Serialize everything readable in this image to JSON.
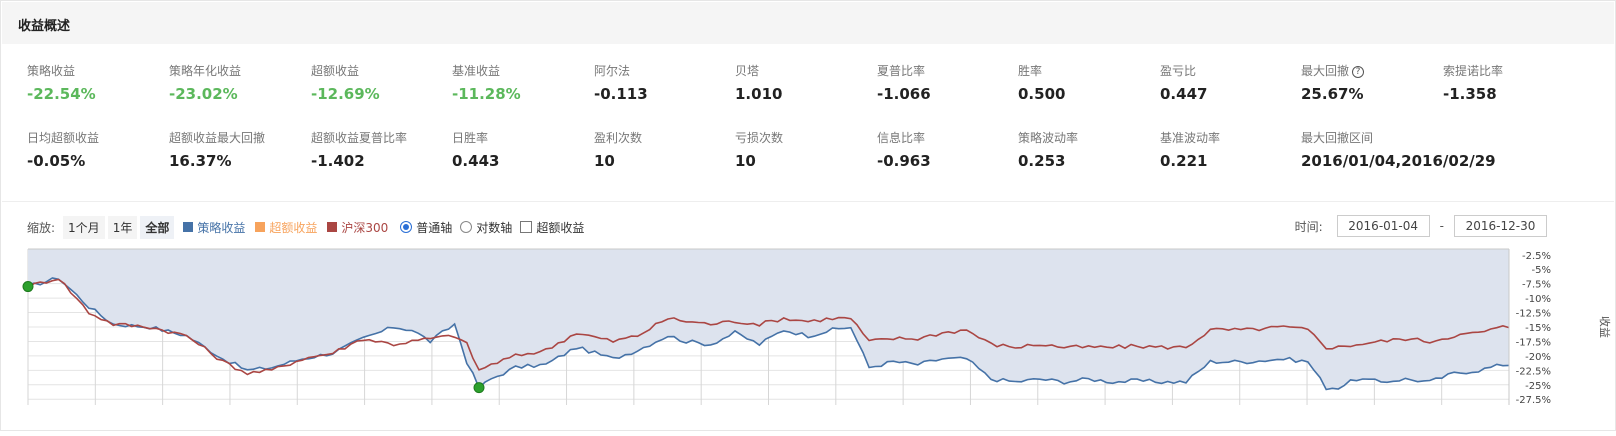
{
  "header": {
    "title": "收益概述"
  },
  "metrics_row1": [
    {
      "label": "策略收益",
      "value": "-22.54%",
      "neg": true
    },
    {
      "label": "策略年化收益",
      "value": "-23.02%",
      "neg": true
    },
    {
      "label": "超额收益",
      "value": "-12.69%",
      "neg": true
    },
    {
      "label": "基准收益",
      "value": "-11.28%",
      "neg": true
    },
    {
      "label": "阿尔法",
      "value": "-0.113",
      "neg": false
    },
    {
      "label": "贝塔",
      "value": "1.010",
      "neg": false
    },
    {
      "label": "夏普比率",
      "value": "-1.066",
      "neg": false
    },
    {
      "label": "胜率",
      "value": "0.500",
      "neg": false
    },
    {
      "label": "盈亏比",
      "value": "0.447",
      "neg": false
    },
    {
      "label": "最大回撤",
      "value": "25.67%",
      "neg": false,
      "help": "?"
    },
    {
      "label": "索提诺比率",
      "value": "-1.358",
      "neg": false
    }
  ],
  "metrics_row2": [
    {
      "label": "日均超额收益",
      "value": "-0.05%"
    },
    {
      "label": "超额收益最大回撤",
      "value": "16.37%"
    },
    {
      "label": "超额收益夏普比率",
      "value": "-1.402"
    },
    {
      "label": "日胜率",
      "value": "0.443"
    },
    {
      "label": "盈利次数",
      "value": "10"
    },
    {
      "label": "亏损次数",
      "value": "10"
    },
    {
      "label": "信息比率",
      "value": "-0.963"
    },
    {
      "label": "策略波动率",
      "value": "0.253"
    },
    {
      "label": "基准波动率",
      "value": "0.221"
    },
    {
      "label": "最大回撤区间",
      "value": "2016/01/04,2016/02/29"
    }
  ],
  "toolbar": {
    "zoom_label": "缩放:",
    "zoom_buttons": [
      "1个月",
      "1年",
      "全部"
    ],
    "legend": [
      {
        "label": "策略收益",
        "color": "#4572a7"
      },
      {
        "label": "超额收益",
        "color": "#f7a35c"
      },
      {
        "label": "沪深300",
        "color": "#aa4643"
      }
    ],
    "axis_normal": "普通轴",
    "axis_log": "对数轴",
    "excess_checkbox": "超额收益",
    "time_label": "时间:",
    "date_from": "2016-01-04",
    "date_to": "2016-12-30",
    "date_sep": "-"
  },
  "chart_data": {
    "type": "line",
    "ylabel": "收益",
    "ylim": [
      -28.5,
      -1.5
    ],
    "yticks": [
      -2.5,
      -5,
      -7.5,
      -10,
      -12.5,
      -15,
      -17.5,
      -20,
      -22.5,
      -25,
      -27.5
    ],
    "ytick_labels": [
      "-2.5%",
      "-5%",
      "-7.5%",
      "-10%",
      "-12.5%",
      "-15%",
      "-17.5%",
      "-20%",
      "-22.5%",
      "-25%",
      "-27.5%"
    ],
    "n_points": 244,
    "grid": true,
    "series": [
      {
        "name": "策略收益",
        "color": "#4572a7",
        "fill": true,
        "anchors": [
          [
            0,
            -8
          ],
          [
            5,
            -6.5
          ],
          [
            10,
            -11.5
          ],
          [
            14,
            -14.5
          ],
          [
            20,
            -15
          ],
          [
            26,
            -16.5
          ],
          [
            32,
            -20.5
          ],
          [
            36,
            -22.5
          ],
          [
            40,
            -22
          ],
          [
            45,
            -20.5
          ],
          [
            50,
            -19.5
          ],
          [
            55,
            -17
          ],
          [
            60,
            -15
          ],
          [
            63,
            -15.5
          ],
          [
            66,
            -17.5
          ],
          [
            70,
            -14.5
          ],
          [
            72,
            -21
          ],
          [
            74,
            -25.5
          ],
          [
            76,
            -24
          ],
          [
            80,
            -22
          ],
          [
            85,
            -21.5
          ],
          [
            90,
            -18.5
          ],
          [
            96,
            -20.5
          ],
          [
            100,
            -19
          ],
          [
            105,
            -16.5
          ],
          [
            108,
            -17.5
          ],
          [
            112,
            -18
          ],
          [
            116,
            -16
          ],
          [
            120,
            -18
          ],
          [
            124,
            -15.5
          ],
          [
            128,
            -16.5
          ],
          [
            132,
            -15.5
          ],
          [
            135,
            -15
          ],
          [
            138,
            -22
          ],
          [
            142,
            -21
          ],
          [
            146,
            -21.5
          ],
          [
            150,
            -20.5
          ],
          [
            154,
            -20.5
          ],
          [
            158,
            -24
          ],
          [
            162,
            -24.5
          ],
          [
            166,
            -24
          ],
          [
            170,
            -24.5
          ],
          [
            174,
            -24
          ],
          [
            178,
            -24.5
          ],
          [
            182,
            -24.3
          ],
          [
            186,
            -24.5
          ],
          [
            190,
            -24.5
          ],
          [
            194,
            -21
          ],
          [
            198,
            -21
          ],
          [
            200,
            -21
          ],
          [
            206,
            -20.5
          ],
          [
            210,
            -21
          ],
          [
            213,
            -25.5
          ],
          [
            215,
            -25.5
          ],
          [
            218,
            -24
          ],
          [
            222,
            -24.5
          ],
          [
            226,
            -24
          ],
          [
            230,
            -24.5
          ],
          [
            234,
            -23
          ],
          [
            238,
            -22.5
          ],
          [
            242,
            -21.5
          ],
          [
            244,
            -21.5
          ]
        ]
      },
      {
        "name": "沪深300",
        "color": "#aa4643",
        "fill": false,
        "anchors": [
          [
            0,
            -8
          ],
          [
            5,
            -6.5
          ],
          [
            10,
            -12.5
          ],
          [
            14,
            -14.5
          ],
          [
            20,
            -15
          ],
          [
            26,
            -16.5
          ],
          [
            32,
            -21
          ],
          [
            36,
            -23
          ],
          [
            40,
            -22.5
          ],
          [
            45,
            -20.5
          ],
          [
            50,
            -19.5
          ],
          [
            55,
            -17
          ],
          [
            60,
            -18
          ],
          [
            63,
            -17.5
          ],
          [
            66,
            -17
          ],
          [
            70,
            -16.5
          ],
          [
            72,
            -18
          ],
          [
            74,
            -22.5
          ],
          [
            76,
            -21.5
          ],
          [
            80,
            -20
          ],
          [
            85,
            -19
          ],
          [
            90,
            -16
          ],
          [
            96,
            -17.5
          ],
          [
            100,
            -16.5
          ],
          [
            105,
            -13.5
          ],
          [
            108,
            -14
          ],
          [
            112,
            -14.5
          ],
          [
            116,
            -14
          ],
          [
            120,
            -14.5
          ],
          [
            124,
            -13.5
          ],
          [
            128,
            -14
          ],
          [
            132,
            -13.5
          ],
          [
            135,
            -13.5
          ],
          [
            138,
            -17.5
          ],
          [
            142,
            -17
          ],
          [
            146,
            -17
          ],
          [
            150,
            -16
          ],
          [
            154,
            -15.5
          ],
          [
            158,
            -18
          ],
          [
            162,
            -18.5
          ],
          [
            166,
            -18
          ],
          [
            170,
            -18.5
          ],
          [
            174,
            -18.5
          ],
          [
            178,
            -18.5
          ],
          [
            182,
            -18.3
          ],
          [
            186,
            -18.5
          ],
          [
            190,
            -18.5
          ],
          [
            194,
            -15.5
          ],
          [
            198,
            -15.5
          ],
          [
            200,
            -15.5
          ],
          [
            206,
            -15
          ],
          [
            210,
            -15.5
          ],
          [
            213,
            -18.5
          ],
          [
            215,
            -18.5
          ],
          [
            218,
            -18
          ],
          [
            222,
            -17.5
          ],
          [
            226,
            -17
          ],
          [
            230,
            -17.5
          ],
          [
            234,
            -16.5
          ],
          [
            238,
            -16
          ],
          [
            242,
            -15
          ],
          [
            244,
            -15
          ]
        ]
      }
    ],
    "markers": [
      {
        "label": "max-drawdown-start",
        "index": 0,
        "value": -8,
        "color": "#2ca02c"
      },
      {
        "label": "max-drawdown-end",
        "index": 74,
        "value": -25.5,
        "color": "#2ca02c"
      }
    ]
  }
}
